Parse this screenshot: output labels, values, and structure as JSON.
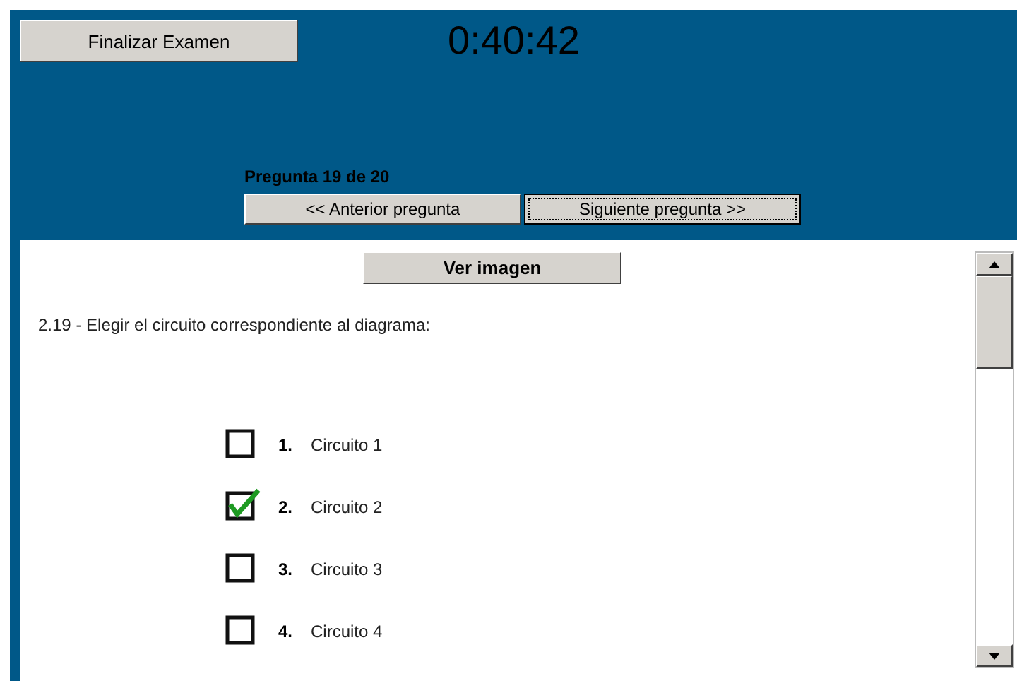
{
  "finish_button": "Finalizar Examen",
  "timer": "0:40:42",
  "progress": "Pregunta 19 de 20",
  "nav_buttons": [
    {
      "label": "<< Anterior pregunta",
      "focused": false
    },
    {
      "label": "Siguiente pregunta >>",
      "focused": true
    }
  ],
  "image_button": "Ver imagen",
  "question": "2.19 - Elegir el circuito correspondiente al diagrama:",
  "options": [
    {
      "number": "1.",
      "label": "Circuito 1",
      "checked": false
    },
    {
      "number": "2.",
      "label": "Circuito 2",
      "checked": true
    },
    {
      "number": "3.",
      "label": "Circuito 3",
      "checked": false
    },
    {
      "number": "4.",
      "label": "Circuito 4",
      "checked": false
    }
  ]
}
